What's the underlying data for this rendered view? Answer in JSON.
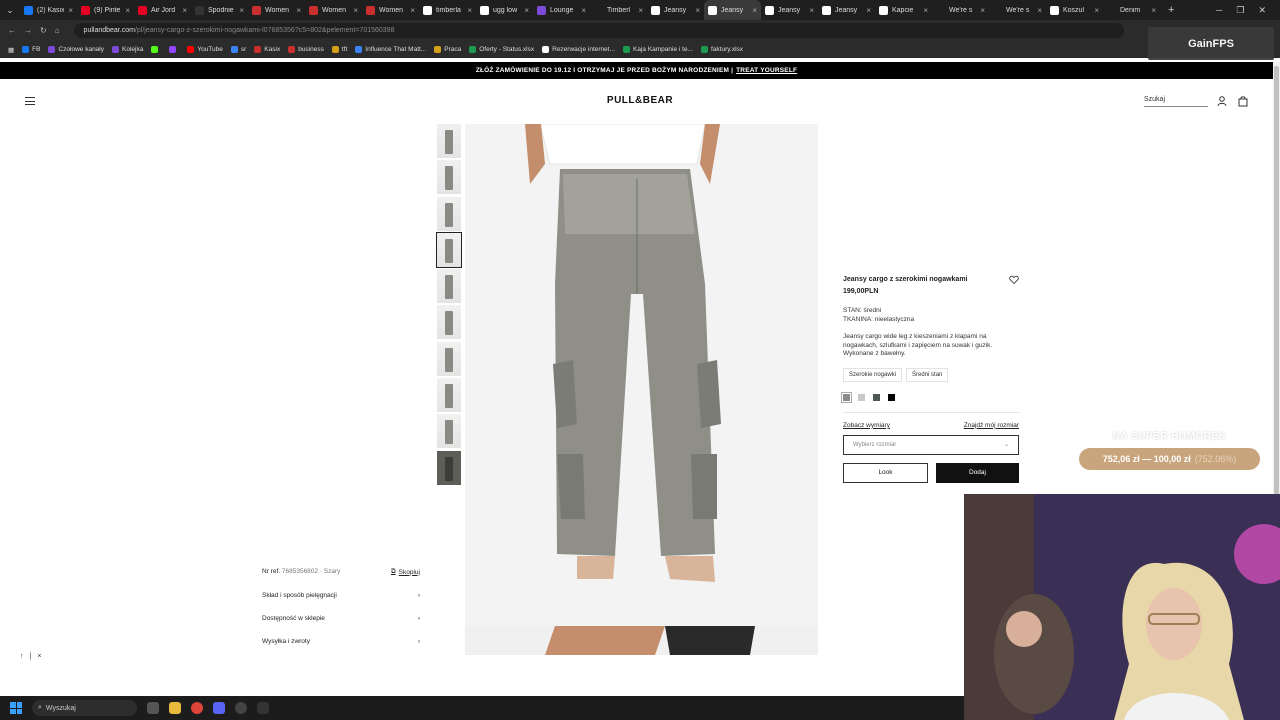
{
  "browser": {
    "tabs": [
      {
        "title": "(2) Kasix",
        "color": "#1877f2",
        "active": false
      },
      {
        "title": "(9) Pinte",
        "color": "#e60023",
        "active": false
      },
      {
        "title": "Air Jord",
        "color": "#e60023",
        "active": false
      },
      {
        "title": "Spodnie",
        "color": "#333333",
        "active": false
      },
      {
        "title": "Women",
        "color": "#c7302e",
        "active": false
      },
      {
        "title": "Women",
        "color": "#c7302e",
        "active": false
      },
      {
        "title": "Women",
        "color": "#c7302e",
        "active": false
      },
      {
        "title": "timberla",
        "color": "#ffffff",
        "active": false
      },
      {
        "title": "ugg low",
        "color": "#ffffff",
        "active": false
      },
      {
        "title": "Lounge",
        "color": "#7b4ad8",
        "active": false
      },
      {
        "title": "Timberl",
        "color": "#1f1f1f",
        "active": false
      },
      {
        "title": "Jeansy",
        "color": "#ffffff",
        "active": false
      },
      {
        "title": "Jeansy",
        "color": "#ffffff",
        "active": true
      },
      {
        "title": "Jeansy",
        "color": "#ffffff",
        "active": false
      },
      {
        "title": "Jeansy",
        "color": "#ffffff",
        "active": false
      },
      {
        "title": "Kapcie",
        "color": "#ffffff",
        "active": false
      },
      {
        "title": "We're s",
        "color": "#1f1f1f",
        "active": false
      },
      {
        "title": "We're s",
        "color": "#1f1f1f",
        "active": false
      },
      {
        "title": "Koszul",
        "color": "#ffffff",
        "active": false
      },
      {
        "title": "Denim",
        "color": "#1f1f1f",
        "active": false
      }
    ],
    "tab_close": "×",
    "new_tab": "+",
    "url_host": "pullandbear.com",
    "url_path": "/pl/jeansy-cargo-z-szerokimi-nogawkami-l07685356?c5=802&pelement=701560398",
    "bookmarks": [
      {
        "label": "FB",
        "color": "#1877f2"
      },
      {
        "label": "Czołowe kanały",
        "color": "#7b4ad8"
      },
      {
        "label": "Kolejka",
        "color": "#7b4ad8"
      },
      {
        "label": "",
        "color": "#53fc18"
      },
      {
        "label": "",
        "color": "#9146ff"
      },
      {
        "label": "YouTube",
        "color": "#ff0000"
      },
      {
        "label": "sr",
        "color": "#3b82f6"
      },
      {
        "label": "Kasix",
        "color": "#c7302e"
      },
      {
        "label": "business",
        "color": "#c7302e"
      },
      {
        "label": "tft",
        "color": "#d4a017"
      },
      {
        "label": "Influence That Matt...",
        "color": "#3b82f6"
      },
      {
        "label": "Praca",
        "color": "#d4a017"
      },
      {
        "label": "Oferty - Status.xlsx",
        "color": "#1d9b50"
      },
      {
        "label": "Rezerwacje internet...",
        "color": "#ffffff"
      },
      {
        "label": "Kaja Kampanie i te...",
        "color": "#1d9b50"
      },
      {
        "label": "faktury.xlsx",
        "color": "#1d9b50"
      }
    ],
    "gainfps_label": "GainFPS"
  },
  "promo_bar": {
    "text": "ZŁÓŻ ZAMÓWIENIE DO 19.12 I OTRZYMAJ JE PRZED BOŻYM NARODZENIEM |",
    "link": "TREAT YOURSELF"
  },
  "header": {
    "logo": "PULL&BEAR",
    "search_label": "Szukaj"
  },
  "product": {
    "title": "Jeansy cargo z szerokimi nogawkami",
    "price": "199,00PLN",
    "stan": "STAN: średni",
    "tkanina": "TKANINA: nieelastyczna",
    "description": "Jeansy cargo wide leg z kieszeniami z klapami na nogawkach, szlufkami i zapięciem na suwak i guzik. Wykonane z bawełny.",
    "tags": [
      "Szerokie nogawki",
      "Średni stan"
    ],
    "swatches": [
      "#8c8c8c",
      "#c9c9c9",
      "#4f5753",
      "#000000"
    ],
    "size_guide_label": "Zobacz wymiary",
    "find_size_label": "Znajdź mój rozmiar",
    "size_select_placeholder": "Wybierz rozmiar",
    "look_button": "Look",
    "add_button": "Dodaj"
  },
  "meta": {
    "ref_label": "Nr ref.",
    "ref_value": "7685356802 · Szary",
    "copy_label": "Skopiuj",
    "accordion": [
      "Skład i sposób pielęgnacji",
      "Dostępność w sklepie",
      "Wysyłka i zwroty"
    ]
  },
  "floating": {
    "up_arrow": "↑",
    "separator": "|",
    "close": "×"
  },
  "stream_overlay": {
    "title": "NA SUPER HUMOREK",
    "amount": "752,06 zł — 100,00 zł",
    "percent": "(752.06%)"
  },
  "taskbar": {
    "search_placeholder": "Wyszukaj"
  }
}
